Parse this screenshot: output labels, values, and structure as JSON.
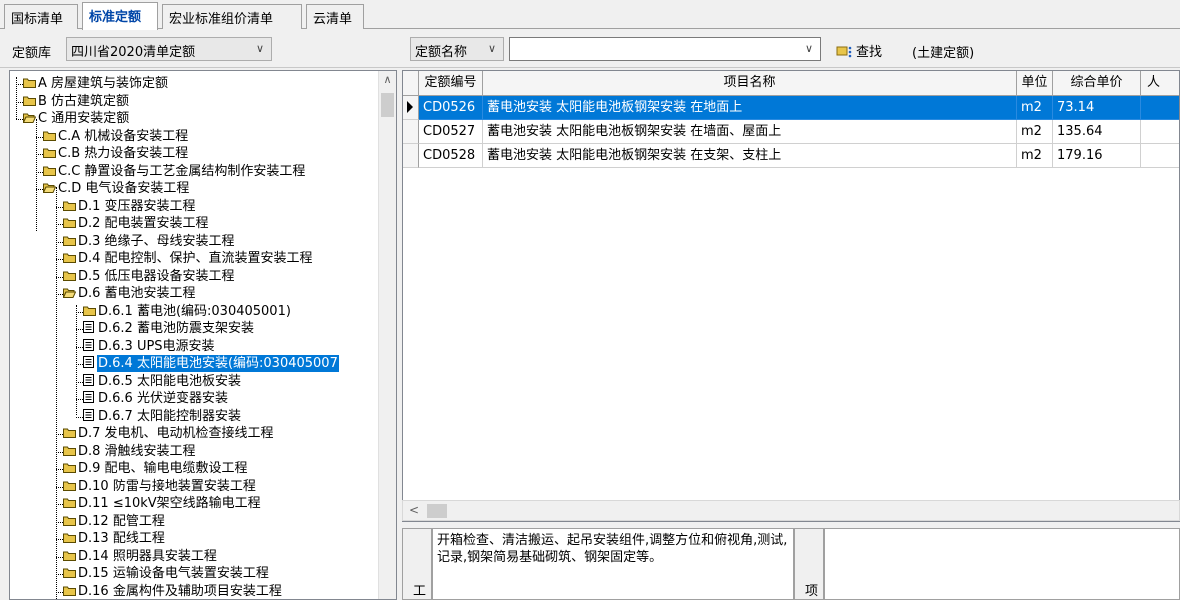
{
  "tabs": [
    {
      "label": "国标清单",
      "active": false
    },
    {
      "label": "标准定额",
      "active": true
    },
    {
      "label": "宏业标准组价清单",
      "active": false
    },
    {
      "label": "云清单",
      "active": false
    }
  ],
  "toolbar": {
    "library_label": "定额库",
    "library_value": "四川省2020清单定额",
    "search_field_value": "定额名称",
    "search_input_value": "",
    "search_button_label": "查找",
    "scope_label": "(土建定额)"
  },
  "tree": [
    {
      "label": "A 房屋建筑与装饰定额",
      "icon": "folder-icon",
      "level": 0
    },
    {
      "label": "B 仿古建筑定额",
      "icon": "folder-icon",
      "level": 0
    },
    {
      "label": "C 通用安装定额",
      "icon": "folder-open-icon",
      "level": 0
    },
    {
      "label": "C.A 机械设备安装工程",
      "icon": "folder-icon",
      "level": 1
    },
    {
      "label": "C.B 热力设备安装工程",
      "icon": "folder-icon",
      "level": 1
    },
    {
      "label": "C.C 静置设备与工艺金属结构制作安装工程",
      "icon": "folder-icon",
      "level": 1
    },
    {
      "label": "C.D 电气设备安装工程",
      "icon": "folder-open-icon",
      "level": 1
    },
    {
      "label": "D.1 变压器安装工程",
      "icon": "folder-icon",
      "level": 2
    },
    {
      "label": "D.2 配电装置安装工程",
      "icon": "folder-icon",
      "level": 2
    },
    {
      "label": "D.3 绝缘子、母线安装工程",
      "icon": "folder-icon",
      "level": 2
    },
    {
      "label": "D.4 配电控制、保护、直流装置安装工程",
      "icon": "folder-icon",
      "level": 2
    },
    {
      "label": "D.5 低压电器设备安装工程",
      "icon": "folder-icon",
      "level": 2
    },
    {
      "label": "D.6 蓄电池安装工程",
      "icon": "folder-open-icon",
      "level": 2
    },
    {
      "label": "D.6.1 蓄电池(编码:030405001)",
      "icon": "folder-icon",
      "level": 3
    },
    {
      "label": "D.6.2 蓄电池防震支架安装",
      "icon": "document-icon",
      "level": 3
    },
    {
      "label": "D.6.3 UPS电源安装",
      "icon": "document-icon",
      "level": 3
    },
    {
      "label": "D.6.4 太阳能电池安装(编码:030405007",
      "icon": "document-icon",
      "level": 3,
      "selected": true
    },
    {
      "label": "D.6.5 太阳能电池板安装",
      "icon": "document-icon",
      "level": 3
    },
    {
      "label": "D.6.6 光伏逆变器安装",
      "icon": "document-icon",
      "level": 3
    },
    {
      "label": "D.6.7 太阳能控制器安装",
      "icon": "document-icon",
      "level": 3
    },
    {
      "label": "D.7 发电机、电动机检查接线工程",
      "icon": "folder-icon",
      "level": 2
    },
    {
      "label": "D.8 滑触线安装工程",
      "icon": "folder-icon",
      "level": 2
    },
    {
      "label": "D.9 配电、输电电缆敷设工程",
      "icon": "folder-icon",
      "level": 2
    },
    {
      "label": "D.10 防雷与接地装置安装工程",
      "icon": "folder-icon",
      "level": 2
    },
    {
      "label": "D.11 ≤10kV架空线路输电工程",
      "icon": "folder-icon",
      "level": 2
    },
    {
      "label": "D.12 配管工程",
      "icon": "folder-icon",
      "level": 2
    },
    {
      "label": "D.13 配线工程",
      "icon": "folder-icon",
      "level": 2
    },
    {
      "label": "D.14 照明器具安装工程",
      "icon": "folder-icon",
      "level": 2
    },
    {
      "label": "D.15 运输设备电气装置安装工程",
      "icon": "folder-icon",
      "level": 2
    },
    {
      "label": "D.16 金属构件及辅助项目安装工程",
      "icon": "folder-icon",
      "level": 2
    }
  ],
  "grid": {
    "columns": [
      "定额编号",
      "项目名称",
      "单位",
      "综合单价",
      "人"
    ],
    "rows": [
      {
        "code": "CD0526",
        "name": "蓄电池安装 太阳能电池板钢架安装 在地面上",
        "unit": "m2",
        "price": "73.14",
        "selected": true
      },
      {
        "code": "CD0527",
        "name": "蓄电池安装 太阳能电池板钢架安装 在墙面、屋面上",
        "unit": "m2",
        "price": "135.64"
      },
      {
        "code": "CD0528",
        "name": "蓄电池安装 太阳能电池板钢架安装 在支架、支柱上",
        "unit": "m2",
        "price": "179.16"
      }
    ]
  },
  "work_panel": {
    "label": "工",
    "content": "开箱检查、清洁搬运、起吊安装组件,调整方位和俯视角,测试,记录,钢架简易基础砌筑、钢架固定等。"
  },
  "item_panel": {
    "label": "项"
  },
  "colors": {
    "selection": "#0078d7",
    "active_tab_text": "#0046a8",
    "folder": "#e8c54a"
  }
}
